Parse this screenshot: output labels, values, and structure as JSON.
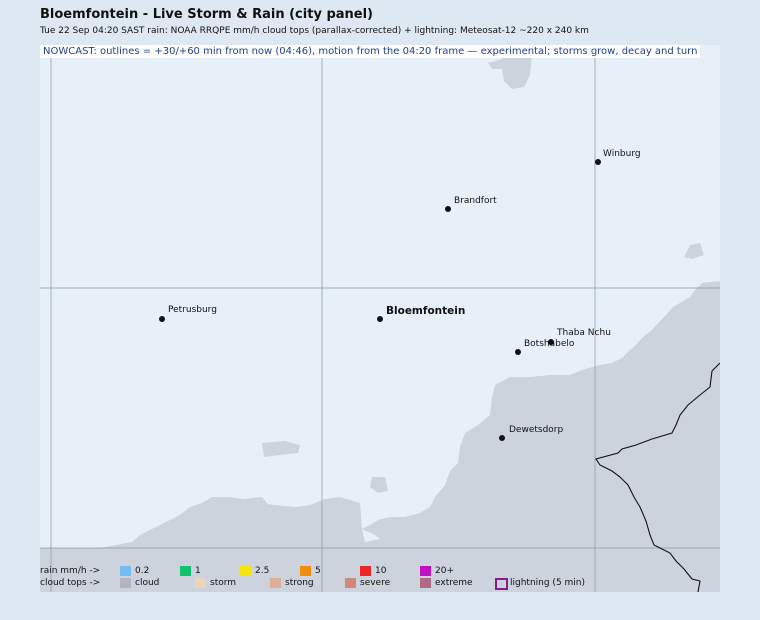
{
  "header": {
    "title": "Bloemfontein - Live Storm & Rain (city panel)",
    "subtitle": "Tue 22 Sep 04:20 SAST   rain: NOAA RRQPE mm/h   cloud tops (parallax-corrected) + lightning: Meteosat-12   ~220 x 240 km"
  },
  "nowcast_note": "NOWCAST: outlines = +30/+60 min from now (04:46), motion from the 04:20 frame — experimental; storms grow, decay and turn",
  "cities": [
    {
      "name": "Winburg",
      "major": false
    },
    {
      "name": "Brandfort",
      "major": false
    },
    {
      "name": "Petrusburg",
      "major": false
    },
    {
      "name": "Bloemfontein",
      "major": true
    },
    {
      "name": "Thaba Nchu",
      "major": false
    },
    {
      "name": "Botshabelo",
      "major": false
    },
    {
      "name": "Dewetsdorp",
      "major": false
    }
  ],
  "legend": {
    "rain_label": "rain mm/h ->",
    "rain_items": [
      {
        "label": "0.2",
        "color": "#74bdf4"
      },
      {
        "label": "1",
        "color": "#0ec46a"
      },
      {
        "label": "2.5",
        "color": "#f5e50a"
      },
      {
        "label": "5",
        "color": "#f28c0c"
      },
      {
        "label": "10",
        "color": "#ee2424"
      },
      {
        "label": "20+",
        "color": "#c10fc1"
      }
    ],
    "cloud_label": "cloud tops ->",
    "cloud_items": [
      {
        "label": "cloud",
        "color": "#b2b7bf"
      },
      {
        "label": "storm",
        "color": "#ead7ba"
      },
      {
        "label": "strong",
        "color": "#deaf96"
      },
      {
        "label": "severe",
        "color": "#cf8a78"
      },
      {
        "label": "extreme",
        "color": "#b16a85"
      },
      {
        "label": "lightning (5 min)",
        "color": "#8b1a8b"
      }
    ]
  },
  "colors": {
    "map_background": "#e7eff9",
    "cloud_cover": "#cdd3dd",
    "gridline": "#8795a8",
    "border_line": "#111111",
    "nowcast_text": "#1f3f8f"
  }
}
